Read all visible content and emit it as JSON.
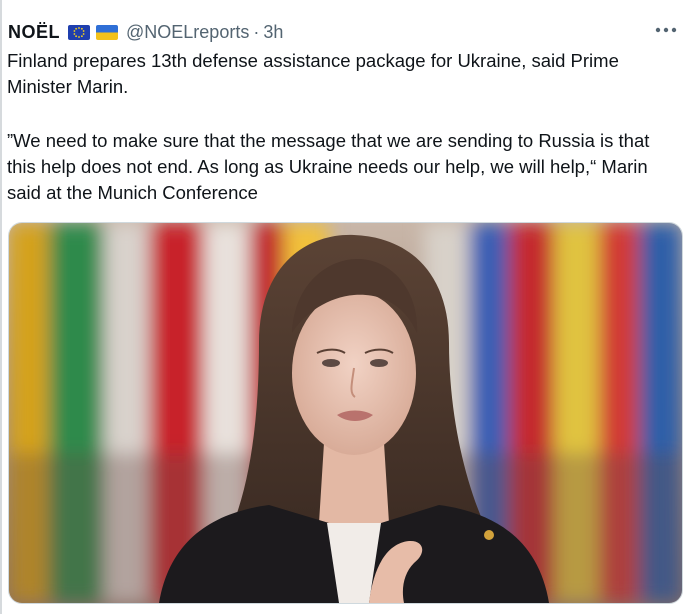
{
  "tweet": {
    "display_name": "NOËL",
    "handle": "@NOELreports",
    "separator": "·",
    "time": "3h",
    "flags": [
      "eu-flag-icon",
      "ukraine-flag-icon"
    ],
    "text_line1": "Finland prepares 13th defense assistance package for Ukraine, said Prime Minister Marin.",
    "text_quote": "”We need to make sure that the message that we are sending to Russia is that this help does not end. As long as Ukraine needs our help, we will help,“ Marin said at the Munich Conference",
    "more_icon": "more-horizontal-icon",
    "colors": {
      "text": "#0f1419",
      "secondary": "#536471",
      "border": "#cfd9de"
    }
  }
}
